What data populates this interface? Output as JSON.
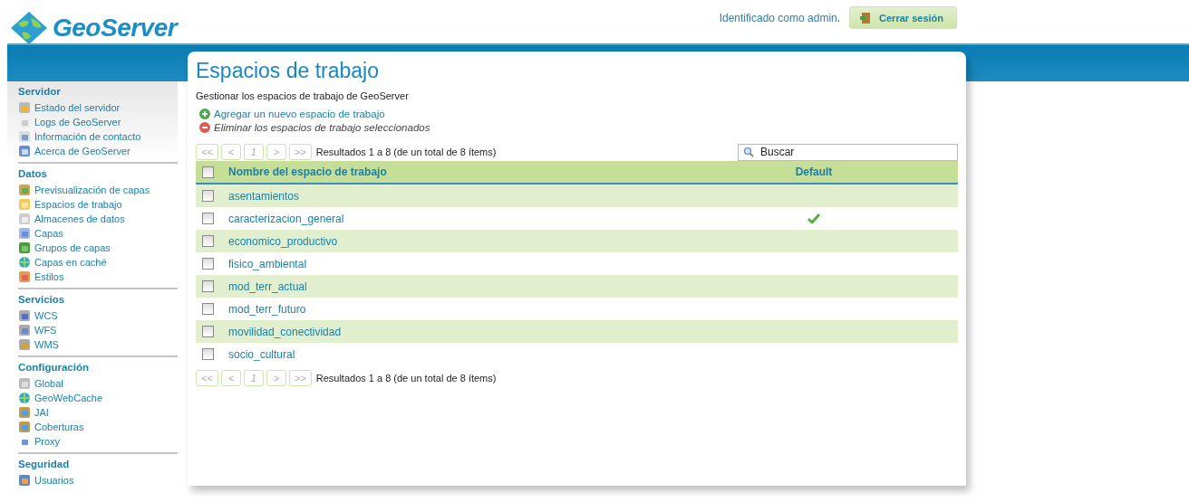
{
  "header": {
    "logo_text": "GeoServer",
    "user_text": "Identificado como admin.",
    "logout_button": "Cerrar sesión"
  },
  "sidebar": {
    "sections": [
      {
        "title": "Servidor",
        "items": [
          "Estado del servidor",
          "Logs de GeoServer",
          "Información de contacto",
          "Acerca de GeoServer"
        ]
      },
      {
        "title": "Datos",
        "items": [
          "Previsualización de capas",
          "Espacios de trabajo",
          "Almacenes de datos",
          "Capas",
          "Grupos de capas",
          "Capas en caché",
          "Estilos"
        ]
      },
      {
        "title": "Servicios",
        "items": [
          "WCS",
          "WFS",
          "WMS"
        ]
      },
      {
        "title": "Configuración",
        "items": [
          "Global",
          "GeoWebCache",
          "JAI",
          "Coberturas",
          "Proxy"
        ]
      },
      {
        "title": "Seguridad",
        "items": [
          "Usuarios"
        ]
      }
    ]
  },
  "page": {
    "title": "Espacios de trabajo",
    "description": "Gestionar los espacios de trabajo de GeoServer",
    "actions": [
      {
        "label": "Agregar un nuevo espacio de trabajo",
        "kind": "add",
        "disabled": false
      },
      {
        "label": "Eliminar los espacios de trabajo seleccionados",
        "kind": "remove",
        "disabled": true
      }
    ]
  },
  "pager_top": {
    "buttons": [
      {
        "label": "<<",
        "disabled": true
      },
      {
        "label": "<",
        "disabled": true
      },
      {
        "label": "1",
        "disabled": true
      },
      {
        "label": ">",
        "disabled": true
      },
      {
        "label": ">>",
        "disabled": true
      }
    ],
    "summary": "Resultados 1 a 8 (de un total de 8 ítems)"
  },
  "search": {
    "placeholder": "Buscar"
  },
  "table": {
    "header_checked": false,
    "columns": [
      "Nombre del espacio de trabajo",
      "Default"
    ],
    "rows": [
      {
        "name": "asentamientos",
        "checked": false,
        "default": false
      },
      {
        "name": "caracterizacion_general",
        "checked": false,
        "default": true
      },
      {
        "name": "economico_productivo",
        "checked": false,
        "default": false
      },
      {
        "name": "fisico_ambiental",
        "checked": false,
        "default": false
      },
      {
        "name": "mod_terr_actual",
        "checked": false,
        "default": false
      },
      {
        "name": "mod_terr_futuro",
        "checked": false,
        "default": false
      },
      {
        "name": "movilidad_conectividad",
        "checked": false,
        "default": false
      },
      {
        "name": "socio_cultural",
        "checked": false,
        "default": false
      }
    ]
  },
  "pager_bottom": {
    "buttons": [
      {
        "label": "<<",
        "disabled": true
      },
      {
        "label": "<",
        "disabled": true
      },
      {
        "label": "1",
        "disabled": true
      },
      {
        "label": ">",
        "disabled": true
      },
      {
        "label": ">>",
        "disabled": true
      }
    ],
    "summary": "Resultados 1 a 8 (de un total de 8 ítems)"
  }
}
